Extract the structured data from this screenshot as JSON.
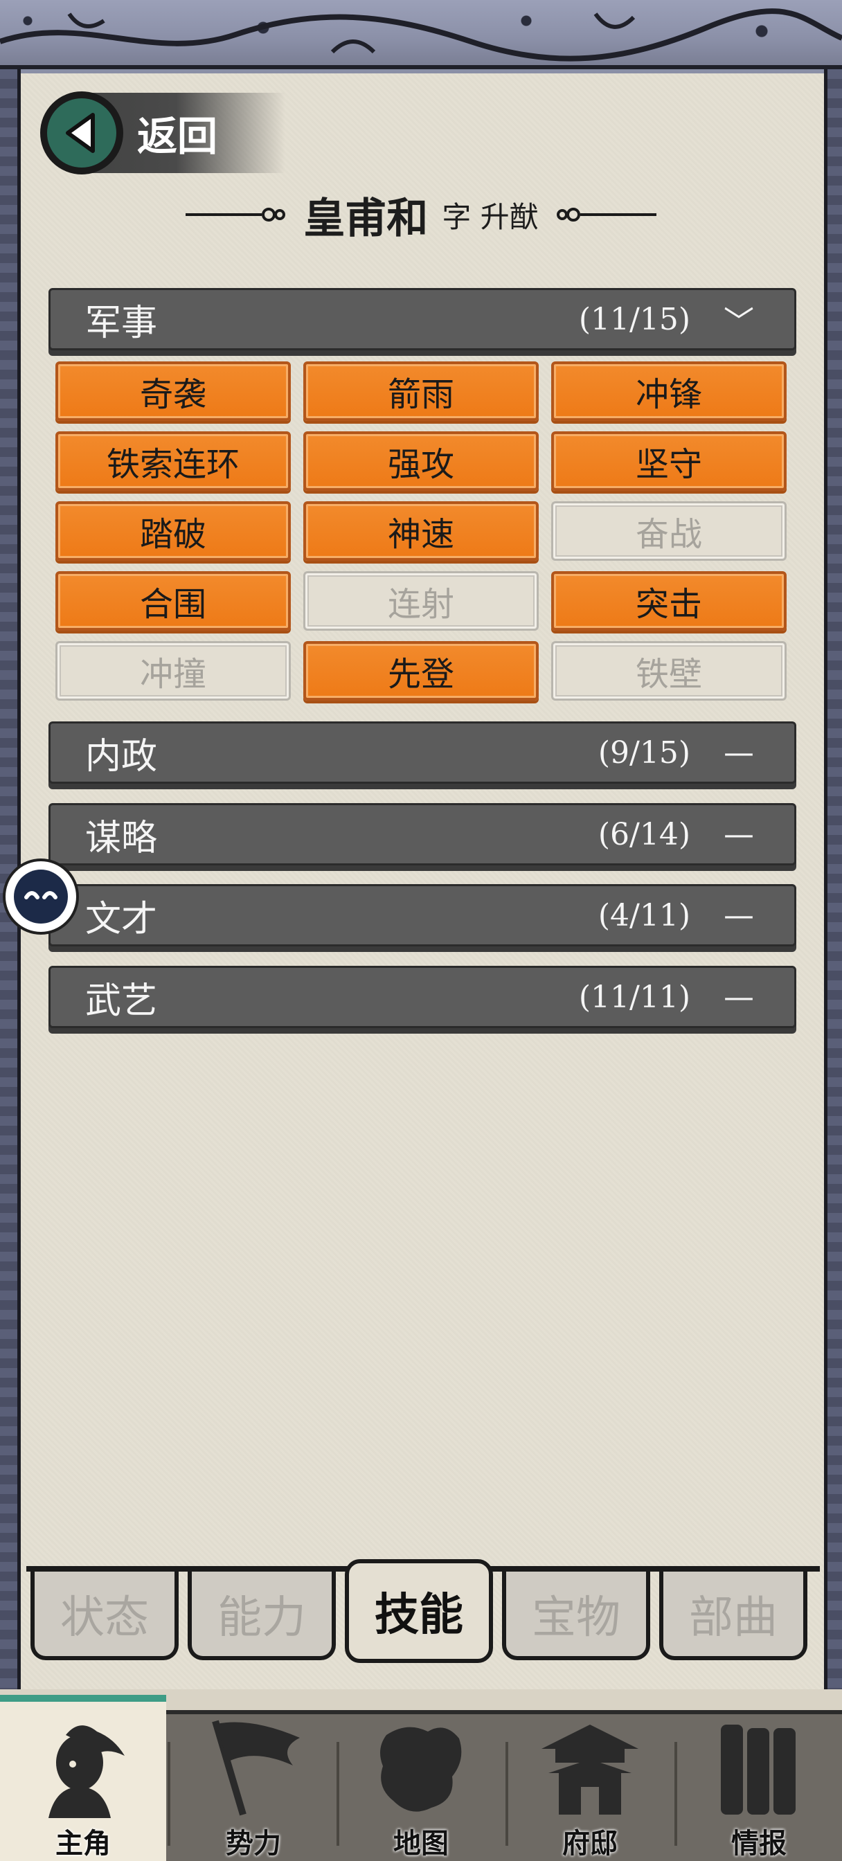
{
  "back": {
    "label": "返回"
  },
  "title": {
    "name": "皇甫和",
    "sub": "字 升猷"
  },
  "categories": [
    {
      "name": "军事",
      "count": "(11/15)",
      "expanded": true
    },
    {
      "name": "内政",
      "count": "(9/15)",
      "expanded": false
    },
    {
      "name": "谋略",
      "count": "(6/14)",
      "expanded": false
    },
    {
      "name": "文才",
      "count": "(4/11)",
      "expanded": false
    },
    {
      "name": "武艺",
      "count": "(11/11)",
      "expanded": false
    }
  ],
  "toggle": {
    "expanded": "﹀",
    "collapsed": "—"
  },
  "skills": [
    {
      "label": "奇袭",
      "learned": true
    },
    {
      "label": "箭雨",
      "learned": true
    },
    {
      "label": "冲锋",
      "learned": true
    },
    {
      "label": "铁索连环",
      "learned": true
    },
    {
      "label": "强攻",
      "learned": true
    },
    {
      "label": "坚守",
      "learned": true
    },
    {
      "label": "踏破",
      "learned": true
    },
    {
      "label": "神速",
      "learned": true
    },
    {
      "label": "奋战",
      "learned": false
    },
    {
      "label": "合围",
      "learned": true
    },
    {
      "label": "连射",
      "learned": false
    },
    {
      "label": "突击",
      "learned": true
    },
    {
      "label": "冲撞",
      "learned": false
    },
    {
      "label": "先登",
      "learned": true
    },
    {
      "label": "铁壁",
      "learned": false
    }
  ],
  "tabs": [
    {
      "label": "状态",
      "active": false
    },
    {
      "label": "能力",
      "active": false
    },
    {
      "label": "技能",
      "active": true
    },
    {
      "label": "宝物",
      "active": false
    },
    {
      "label": "部曲",
      "active": false
    }
  ],
  "nav": [
    {
      "label": "主角",
      "icon": "hero-icon",
      "active": true
    },
    {
      "label": "势力",
      "icon": "flag-icon",
      "active": false
    },
    {
      "label": "地图",
      "icon": "map-icon",
      "active": false
    },
    {
      "label": "府邸",
      "icon": "mansion-icon",
      "active": false
    },
    {
      "label": "情报",
      "icon": "scroll-icon",
      "active": false
    }
  ],
  "colors": {
    "skill_on": "#f08322",
    "skill_off": "#e3ded2",
    "header": "#5c5c5c",
    "paper": "#e4dfd2",
    "accent": "#3e9c86"
  }
}
